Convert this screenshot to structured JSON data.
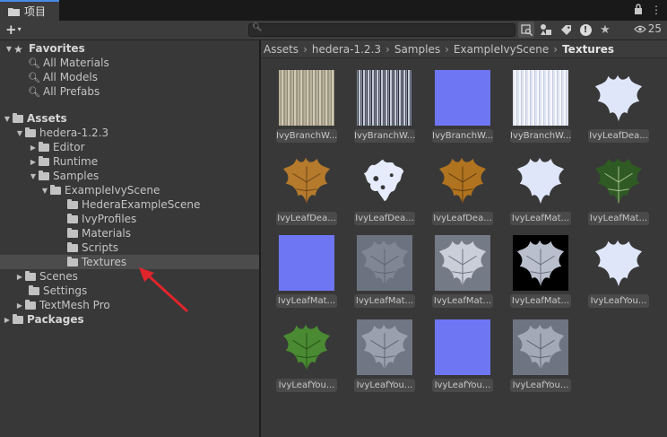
{
  "tab": {
    "label": "项目"
  },
  "search": {
    "placeholder": "",
    "value": ""
  },
  "hidden_count": "25",
  "tree": {
    "favorites": {
      "label": "Favorites",
      "items": [
        "All Materials",
        "All Models",
        "All Prefabs"
      ]
    },
    "assets_label": "Assets",
    "hedera_label": "hedera-1.2.3",
    "editor_label": "Editor",
    "runtime_label": "Runtime",
    "samples_label": "Samples",
    "example_label": "ExampleIvyScene",
    "example_children": [
      "HederaExampleScene",
      "IvyProfiles",
      "Materials",
      "Scripts",
      "Textures"
    ],
    "scenes_label": "Scenes",
    "settings_label": "Settings",
    "textmesh_label": "TextMesh Pro",
    "packages_label": "Packages"
  },
  "breadcrumb": [
    "Assets",
    "hedera-1.2.3",
    "Samples",
    "ExampleIvyScene",
    "Textures"
  ],
  "assets": [
    {
      "label": "IvyBranchW...",
      "thumb": "bark1"
    },
    {
      "label": "IvyBranchW...",
      "thumb": "bark2"
    },
    {
      "label": "IvyBranchW...",
      "thumb": "normal"
    },
    {
      "label": "IvyBranchW...",
      "thumb": "white"
    },
    {
      "label": "IvyLeafDea...",
      "thumb": "leaf-white"
    },
    {
      "label": "IvyLeafDea...",
      "thumb": "leaf-dead"
    },
    {
      "label": "IvyLeafDea...",
      "thumb": "leaf-splotch"
    },
    {
      "label": "IvyLeafDea...",
      "thumb": "leaf-dead2"
    },
    {
      "label": "IvyLeafMat...",
      "thumb": "leaf-white"
    },
    {
      "label": "IvyLeafMat...",
      "thumb": "leaf-green-dark"
    },
    {
      "label": "IvyLeafMat...",
      "thumb": "normal"
    },
    {
      "label": "IvyLeafMat...",
      "thumb": "leaf-gray-flat"
    },
    {
      "label": "IvyLeafMat...",
      "thumb": "leaf-gray-light"
    },
    {
      "label": "IvyLeafMat...",
      "thumb": "leaf-gray-black"
    },
    {
      "label": "IvyLeafYou...",
      "thumb": "leaf-white"
    },
    {
      "label": "IvyLeafYou...",
      "thumb": "leaf-green"
    },
    {
      "label": "IvyLeafYou...",
      "thumb": "leaf-gray-young"
    },
    {
      "label": "IvyLeafYou...",
      "thumb": "normal"
    },
    {
      "label": "IvyLeafYou...",
      "thumb": "leaf-gray-young2"
    }
  ],
  "colors": {
    "accent": "#4a8ae6",
    "selection": "#4c4c4c",
    "arrow": "#e0242b",
    "normal_map": "#6f76f4"
  }
}
